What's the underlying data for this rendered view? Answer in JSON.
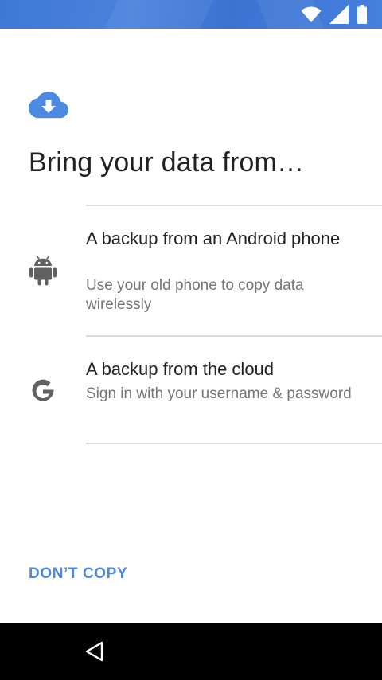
{
  "status_bar": {
    "icons": [
      "wifi-icon",
      "cellular-signal-icon",
      "battery-icon"
    ],
    "background": "#3f78d6"
  },
  "header": {
    "icon": "cloud-download-icon",
    "title": "Bring your data from…"
  },
  "options": [
    {
      "icon": "android-icon",
      "title": "A backup from an Android phone",
      "subtitle": "Use your old phone to copy data wirelessly"
    },
    {
      "icon": "google-g-icon",
      "title": "A backup from the cloud",
      "subtitle": "Sign in with your username & password"
    }
  ],
  "actions": {
    "dont_copy_label": "DON’T COPY"
  },
  "nav_bar": {
    "icons": [
      "back-icon"
    ]
  },
  "colors": {
    "accent": "#4a8ae0",
    "title_text": "#212121",
    "secondary_text": "#757575",
    "divider": "#dcdcdc",
    "icon_gray": "#616161"
  }
}
